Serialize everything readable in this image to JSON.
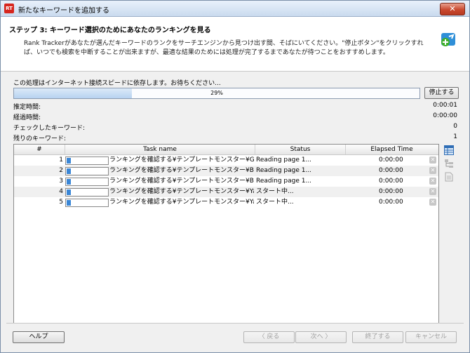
{
  "window": {
    "title": "新たなキーワードを追加する",
    "app_icon_text": "RT",
    "close_glyph": "✕"
  },
  "header": {
    "step_title": "ステップ 3: キーワード選択のためにあなたのランキングを見る",
    "description": "Rank Trackerがあなたが選んだキーワードのランクをサーチエンジンから見つけ出す間、そばにいてください。\"停止ボタン\"をクリックすれば、いつでも検索を中断することが出来ますが、最適な結果のためには処理が完了するまであなたが待つことをおすすめします。"
  },
  "progress": {
    "status_line": "この処理はインターネット接続スピードに依存します。お待ちください...",
    "percent_label": "29%",
    "fraction": 0.29,
    "stop_button": "停止する"
  },
  "stats": [
    {
      "label": "推定時間:",
      "value": "0:00:01"
    },
    {
      "label": "経過時間:",
      "value": "0:00:00"
    },
    {
      "label": "チェックしたキーワード:",
      "value": "0"
    },
    {
      "label": "残りのキーワード:",
      "value": "1"
    }
  ],
  "table": {
    "headers": [
      "#",
      "Task name",
      "Status",
      "Elapsed Time"
    ],
    "rows": [
      {
        "num": "1",
        "task": "ランキングを確認する¥テンプレートモンスター¥Googl...",
        "status": "Reading page 1...",
        "elapsed": "0:00:00"
      },
      {
        "num": "2",
        "task": "ランキングを確認する¥テンプレートモンスター¥Bing (...",
        "status": "Reading page 1...",
        "elapsed": "0:00:00"
      },
      {
        "num": "3",
        "task": "ランキングを確認する¥テンプレートモンスター¥Bing (...",
        "status": "Reading page 1...",
        "elapsed": "0:00:00"
      },
      {
        "num": "4",
        "task": "ランキングを確認する¥テンプレートモンスター¥Yahoo...",
        "status": "スタート中...",
        "elapsed": "0:00:00"
      },
      {
        "num": "5",
        "task": "ランキングを確認する¥テンプレートモンスター¥Yahoo...",
        "status": "スタート中...",
        "elapsed": "0:00:00"
      }
    ]
  },
  "footer": {
    "help": "ヘルプ",
    "back": "〈 戻る",
    "next": "次へ 〉",
    "finish": "終了する",
    "cancel": "キャンセル"
  },
  "icons": {
    "table_view": "table-view-icon",
    "tree_view": "tree-view-icon",
    "report": "report-icon",
    "logo": "add-keyword-icon"
  },
  "colors": {
    "progress_fill": "#b7d2f0",
    "task_bar": "#3a86d6",
    "close": "#c9492f"
  }
}
